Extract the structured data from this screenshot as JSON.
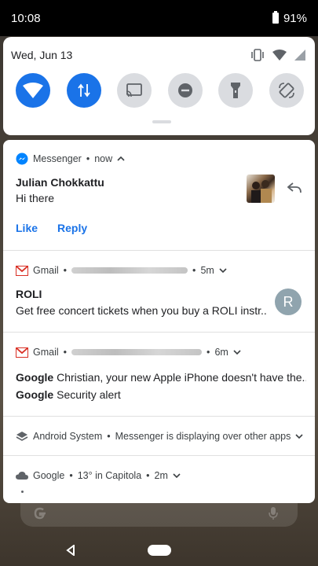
{
  "status_bar": {
    "time": "10:08",
    "battery": "91%"
  },
  "quick_settings": {
    "date": "Wed, Jun 13",
    "tiles": [
      {
        "name": "wifi",
        "on": true
      },
      {
        "name": "mobile-data",
        "on": true
      },
      {
        "name": "cast",
        "on": false
      },
      {
        "name": "do-not-disturb",
        "on": false
      },
      {
        "name": "flashlight",
        "on": false
      },
      {
        "name": "auto-rotate",
        "on": false
      }
    ]
  },
  "notifications": {
    "messenger": {
      "app": "Messenger",
      "time": "now",
      "title": "Julian Chokkattu",
      "text": "Hi there",
      "action_like": "Like",
      "action_reply": "Reply"
    },
    "gmail1": {
      "app": "Gmail",
      "time": "5m",
      "title": "ROLI",
      "text": "Get free concert tickets when you buy a ROLI instr..",
      "avatar_letter": "R"
    },
    "gmail2": {
      "app": "Gmail",
      "time": "6m",
      "line1_sender": "Google",
      "line1_text": "Christian, your new Apple iPhone doesn't have the...",
      "line2_sender": "Google",
      "line2_text": "Security alert"
    },
    "android_system": {
      "app": "Android System",
      "text": "Messenger is displaying over other apps"
    },
    "weather": {
      "app": "Google",
      "text": "13° in Capitola",
      "time": "2m"
    }
  },
  "colors": {
    "accent": "#1a73e8",
    "gmail_red": "#d93025",
    "messenger_blue": "#0084ff"
  }
}
